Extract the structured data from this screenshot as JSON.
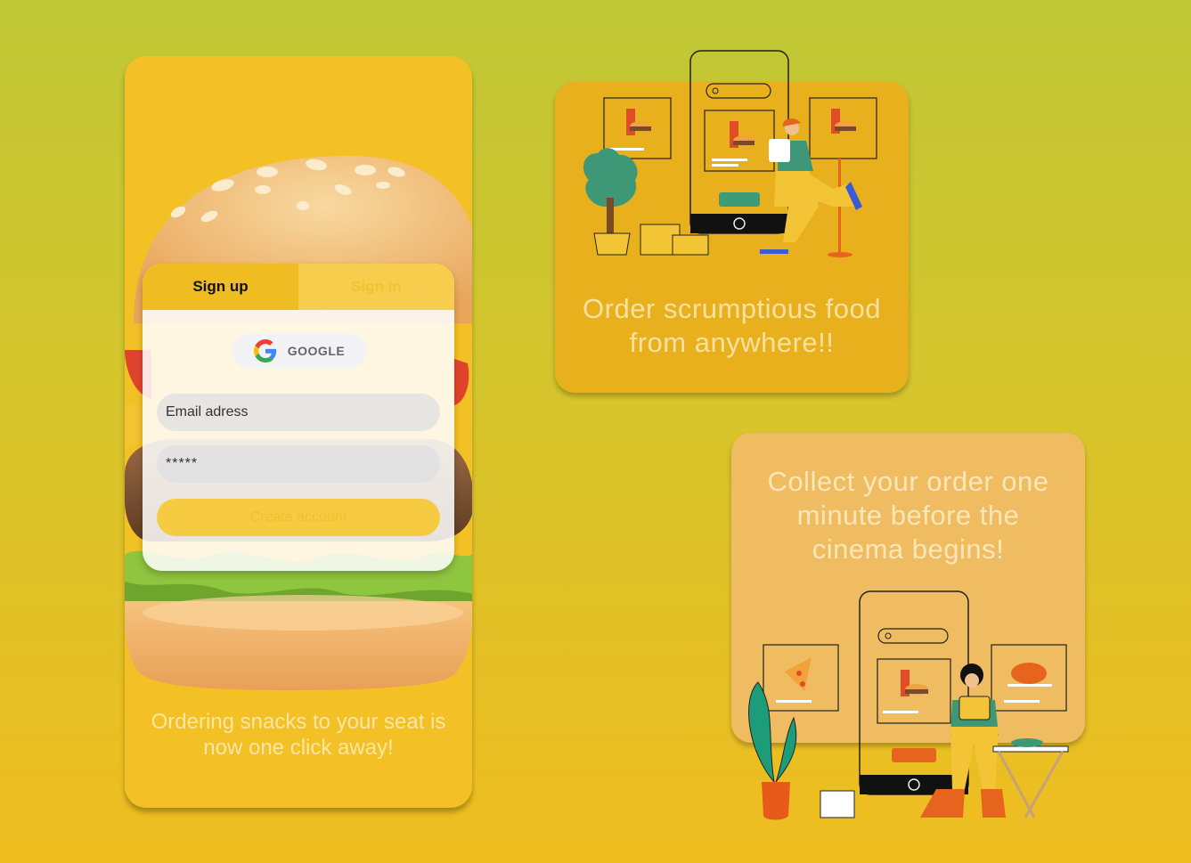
{
  "login": {
    "tab_signup": "Sign up",
    "tab_signin": "Sign in",
    "google_label": "GOOGLE",
    "email_value": "Email adress",
    "password_value": "*****",
    "create_button": "Create account"
  },
  "phone_caption": {
    "line1": "Ordering snacks to your seat is",
    "line2": "now one click away!"
  },
  "card1": {
    "line1": "Order scrumptious food",
    "line2": "from anywhere!!"
  },
  "card2": {
    "line1": "Collect your order one",
    "line2": "minute before the",
    "line3": "cinema begins!"
  },
  "colors": {
    "accent": "#efbc22",
    "card1_bg": "#e8b01c",
    "card2_bg": "#f0bc62",
    "phone_bg": "#f3c125"
  },
  "icons": [
    "google-icon",
    "burger-illustration",
    "delivery-illustration",
    "pickup-illustration"
  ]
}
